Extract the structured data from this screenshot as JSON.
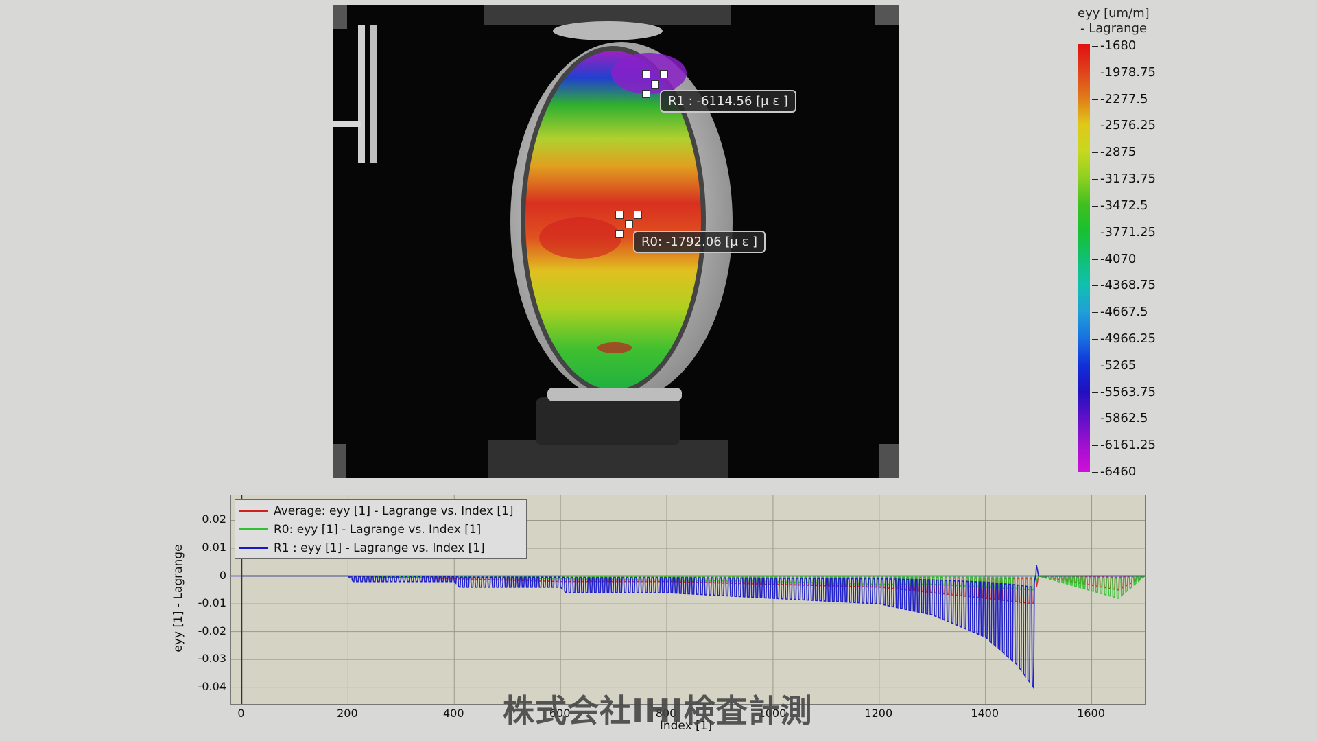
{
  "image_panel": {
    "callouts": [
      {
        "id": "R1",
        "label": "R1 : -6114.56 [μ ε ]"
      },
      {
        "id": "R0",
        "label": "R0: -1792.06 [μ ε ]"
      }
    ]
  },
  "colorbar": {
    "title_line1": "eyy [um/m]",
    "title_line2": "- Lagrange",
    "labels": [
      "-1680",
      "-1978.75",
      "-2277.5",
      "-2576.25",
      "-2875",
      "-3173.75",
      "-3472.5",
      "-3771.25",
      "-4070",
      "-4368.75",
      "-4667.5",
      "-4966.25",
      "-5265",
      "-5563.75",
      "-5862.5",
      "-6161.25",
      "-6460"
    ],
    "colors": [
      "#e01010",
      "#e0401c",
      "#e07a18",
      "#e0c818",
      "#c8d820",
      "#90d020",
      "#40c020",
      "#18c030",
      "#10c070",
      "#10c0b0",
      "#20a0d8",
      "#1870e0",
      "#1030d8",
      "#2010c0",
      "#6010c8",
      "#a010d0",
      "#d010d8"
    ]
  },
  "chart_data": {
    "type": "line",
    "xlabel": "Index [1]",
    "ylabel": "eyy [1] - Lagrange",
    "xlim": [
      -20,
      1700
    ],
    "ylim": [
      -0.046,
      0.029
    ],
    "x_ticks": [
      "0",
      "200",
      "400",
      "600",
      "800",
      "1000",
      "1200",
      "1400",
      "1600"
    ],
    "y_ticks": [
      "0.02",
      "0.01",
      "0",
      "-0.01",
      "-0.02",
      "-0.03",
      "-0.04"
    ],
    "grid": true,
    "legend_position": "top-left",
    "series": [
      {
        "name": "Average: eyy [1] - Lagrange vs. Index [1]",
        "color": "#d02020",
        "envelope": [
          [
            0,
            0
          ],
          [
            200,
            0
          ],
          [
            400,
            -0.001
          ],
          [
            600,
            -0.002
          ],
          [
            800,
            -0.002
          ],
          [
            1000,
            -0.003
          ],
          [
            1200,
            -0.004
          ],
          [
            1300,
            -0.006
          ],
          [
            1400,
            -0.008
          ],
          [
            1490,
            -0.01
          ],
          [
            1500,
            0
          ],
          [
            1650,
            -0.005
          ],
          [
            1700,
            0
          ]
        ]
      },
      {
        "name": "R0: eyy [1] - Lagrange vs. Index [1]",
        "color": "#30c030",
        "envelope": [
          [
            0,
            0
          ],
          [
            200,
            0
          ],
          [
            400,
            -0.0005
          ],
          [
            600,
            -0.001
          ],
          [
            800,
            -0.0015
          ],
          [
            1000,
            -0.002
          ],
          [
            1200,
            -0.003
          ],
          [
            1300,
            -0.003
          ],
          [
            1400,
            -0.004
          ],
          [
            1490,
            -0.005
          ],
          [
            1500,
            0
          ],
          [
            1650,
            -0.008
          ],
          [
            1700,
            0
          ]
        ]
      },
      {
        "name": "R1 : eyy [1] - Lagrange vs. Index [1]",
        "color": "#1818c8",
        "envelope": [
          [
            0,
            0
          ],
          [
            200,
            0
          ],
          [
            210,
            -0.002
          ],
          [
            400,
            -0.002
          ],
          [
            410,
            -0.004
          ],
          [
            600,
            -0.004
          ],
          [
            610,
            -0.006
          ],
          [
            800,
            -0.006
          ],
          [
            1000,
            -0.008
          ],
          [
            1200,
            -0.01
          ],
          [
            1300,
            -0.014
          ],
          [
            1400,
            -0.022
          ],
          [
            1460,
            -0.032
          ],
          [
            1490,
            -0.04
          ],
          [
            1495,
            0.005
          ],
          [
            1500,
            0
          ],
          [
            1700,
            0
          ]
        ]
      }
    ]
  },
  "watermark": "株式会社IHI検査計測"
}
